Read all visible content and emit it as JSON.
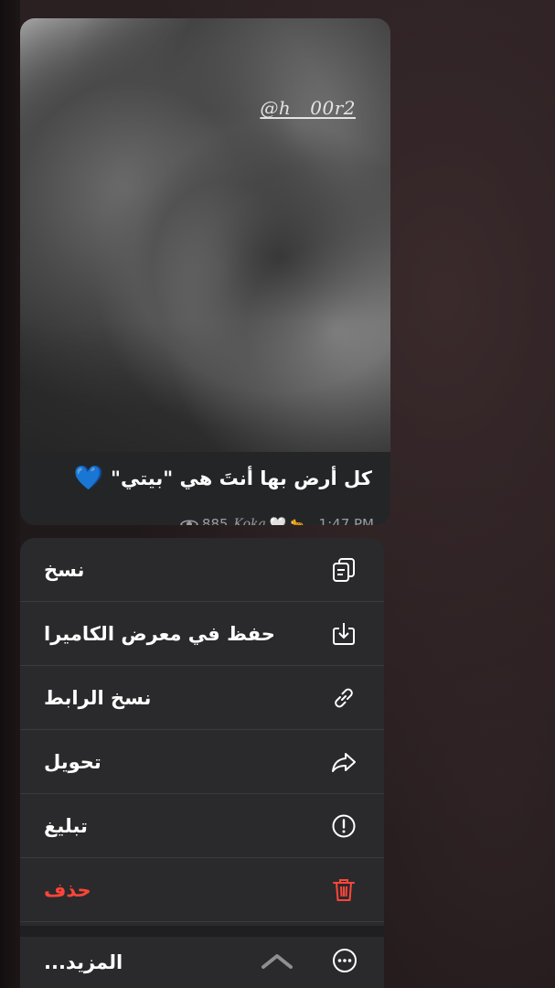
{
  "message": {
    "watermark": "@h__00r2",
    "caption": "كل أرض بها أنتَ هي \"بيتي\"",
    "caption_emoji": "💙",
    "views": "885",
    "author": "Koka",
    "author_heart": "🤍",
    "author_animal": "🐆",
    "time": ", 1:47 PM"
  },
  "menu": {
    "items": [
      {
        "label": "نسخ",
        "icon": "copy-icon"
      },
      {
        "label": "حفظ في معرض الكاميرا",
        "icon": "save-to-gallery-icon"
      },
      {
        "label": "نسخ الرابط",
        "icon": "link-icon"
      },
      {
        "label": "تحويل",
        "icon": "forward-icon"
      },
      {
        "label": "تبليغ",
        "icon": "report-icon"
      },
      {
        "label": "حذف",
        "icon": "trash-icon"
      }
    ],
    "more": {
      "label": "المزيد...",
      "icon": "more-icon",
      "chevron": "chevron-up-icon"
    }
  },
  "colors": {
    "danger": "#ff453a",
    "caption_emoji": "#2f8cff",
    "menu_background": "#2a2a2c"
  }
}
